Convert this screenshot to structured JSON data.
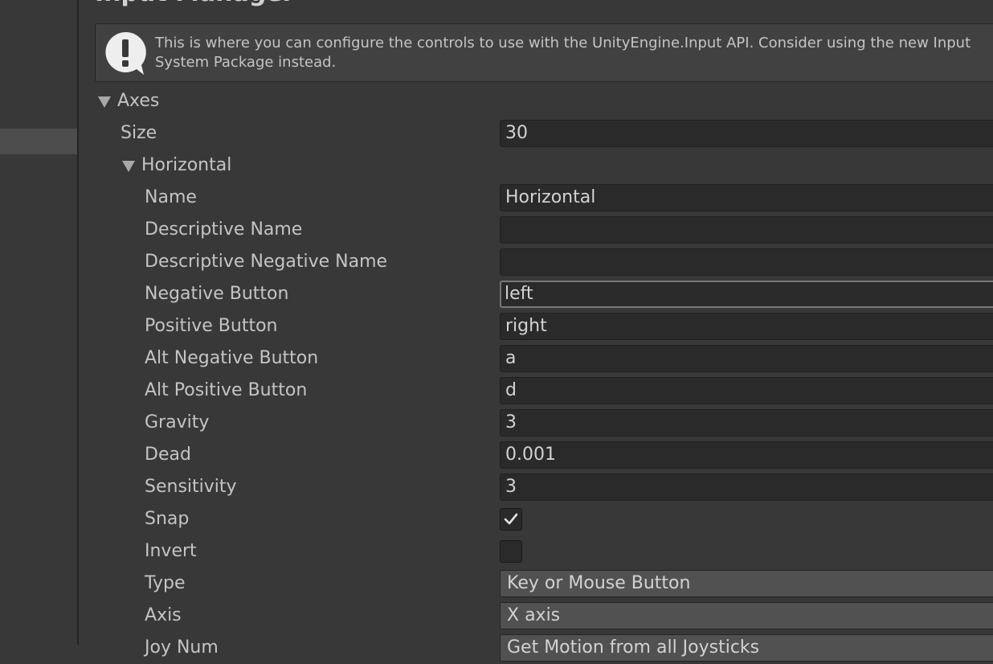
{
  "page_title": "Input Manager",
  "help_box": {
    "text": "This is where you can configure the controls to use with the UnityEngine.Input API. Consider using the new Input System Package instead."
  },
  "axes": {
    "label": "Axes",
    "size_label": "Size",
    "size_value": "30",
    "horizontal": {
      "label": "Horizontal",
      "fields": {
        "name": {
          "label": "Name",
          "value": "Horizontal"
        },
        "descriptive_name": {
          "label": "Descriptive Name",
          "value": ""
        },
        "descriptive_negative_name": {
          "label": "Descriptive Negative Name",
          "value": ""
        },
        "negative_button": {
          "label": "Negative Button",
          "value": "left"
        },
        "positive_button": {
          "label": "Positive Button",
          "value": "right"
        },
        "alt_negative_button": {
          "label": "Alt Negative Button",
          "value": "a"
        },
        "alt_positive_button": {
          "label": "Alt Positive Button",
          "value": "d"
        },
        "gravity": {
          "label": "Gravity",
          "value": "3"
        },
        "dead": {
          "label": "Dead",
          "value": "0.001"
        },
        "sensitivity": {
          "label": "Sensitivity",
          "value": "3"
        },
        "snap": {
          "label": "Snap",
          "checked": true
        },
        "invert": {
          "label": "Invert",
          "checked": false
        },
        "type": {
          "label": "Type",
          "value": "Key or Mouse Button"
        },
        "axis": {
          "label": "Axis",
          "value": "X axis"
        },
        "joy_num": {
          "label": "Joy Num",
          "value": "Get Motion from all Joysticks"
        }
      }
    }
  },
  "colors": {
    "background": "#383838",
    "field": "#2a2a2a",
    "dropdown": "#515151",
    "text": "#c4c4c4"
  }
}
